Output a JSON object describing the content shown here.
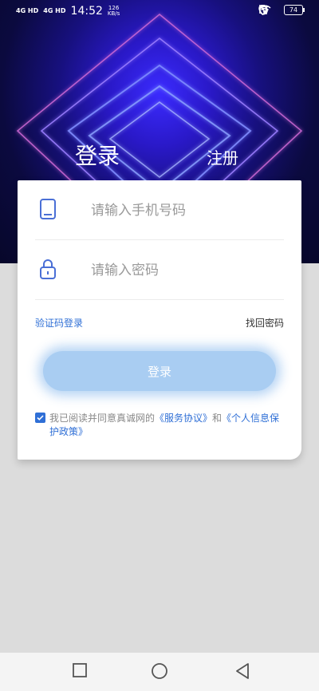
{
  "status_bar": {
    "signal1": "4G HD",
    "signal2": "4G HD",
    "time": "14:52",
    "speed_value": "126",
    "speed_unit": "KB/s",
    "battery": "74"
  },
  "tabs": {
    "login": "登录",
    "register": "注册"
  },
  "form": {
    "phone_placeholder": "请输入手机号码",
    "password_placeholder": "请输入密码",
    "sms_login": "验证码登录",
    "forgot_password": "找回密码",
    "login_button": "登录"
  },
  "agreement": {
    "checked": true,
    "prefix": "我已阅读并同意真诚网的",
    "service_link": "《服务协议》",
    "and": "和",
    "privacy_link": "《个人信息保护政策》"
  },
  "icons": [
    "phone-icon",
    "lock-icon",
    "checkbox-icon",
    "square-icon",
    "circle-icon",
    "back-triangle-icon"
  ],
  "colors": {
    "accent": "#2f6fd6",
    "button": "#a9cdf2",
    "hero_dark": "#0b0a3f",
    "hero_glow": "#3b2bff"
  }
}
